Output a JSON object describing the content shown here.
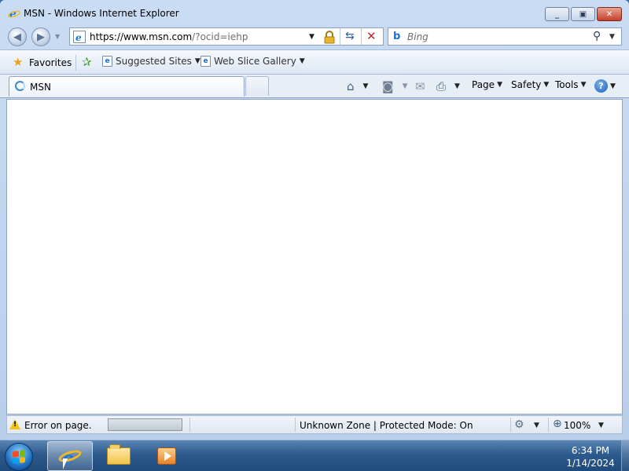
{
  "window": {
    "title": "MSN - Windows Internet Explorer",
    "controls": {
      "minimize": "▭",
      "maximize": "□",
      "close": "✕"
    }
  },
  "navigation": {
    "back_icon": "back-arrow-icon",
    "forward_icon": "forward-arrow-icon",
    "address": {
      "prefix": "https://www.",
      "host": "msn.com",
      "path": "/?ocid=iehp"
    },
    "search": {
      "logo": "b",
      "placeholder": "Bing"
    }
  },
  "favorites_bar": {
    "favorites_label": "Favorites",
    "items": [
      {
        "label": "Suggested Sites"
      },
      {
        "label": "Web Slice Gallery"
      }
    ]
  },
  "tabs": [
    {
      "label": "MSN",
      "active": true,
      "loading": true
    }
  ],
  "command_bar": {
    "page_label": "Page",
    "safety_label": "Safety",
    "tools_label": "Tools",
    "help_label": "?"
  },
  "status_bar": {
    "message": "Error on page.",
    "zone": "Unknown Zone | Protected Mode: On",
    "zoom": "100%",
    "warning_glyph": "!"
  },
  "taskbar": {
    "clock_time": "6:34 PM",
    "clock_date": "1/14/2024",
    "apps": [
      {
        "name": "internet-explorer",
        "active": true
      },
      {
        "name": "windows-explorer",
        "active": false
      },
      {
        "name": "windows-media-player",
        "active": false
      }
    ]
  },
  "colors": {
    "title_bg": "#c9dcf3",
    "taskbar_bg": "#2d5a8c",
    "close_button": "#c4402b",
    "link_blue": "#1d6fd1"
  }
}
